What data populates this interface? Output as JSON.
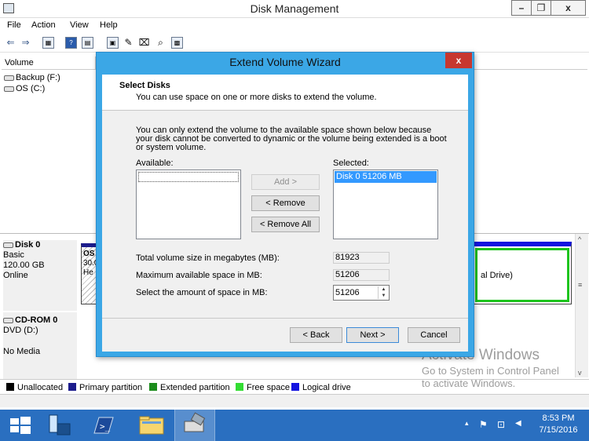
{
  "window": {
    "title": "Disk Management",
    "min": "–",
    "max": "❐",
    "close": "x"
  },
  "menu": [
    "File",
    "Action",
    "View",
    "Help"
  ],
  "toolbar": {
    "back": "⇐",
    "forward": "⇒",
    "btn3": "▦",
    "btn4": "?",
    "btn5": "▤",
    "btn6": "▣",
    "btn7": "✎",
    "btn8": "⌧",
    "btn9": "⌕",
    "btn10": "▩"
  },
  "volume_list": {
    "column": "Volume",
    "rows": [
      "Backup (F:)",
      "OS (C:)"
    ]
  },
  "disks": {
    "disk0": {
      "name": "Disk 0",
      "type": "Basic",
      "size": "120.00 GB",
      "status": "Online",
      "part1_lines": [
        "OS",
        "30.0",
        "He"
      ],
      "part2_text": "al Drive)"
    },
    "cdrom": {
      "name": "CD-ROM 0",
      "type": "DVD (D:)",
      "status": "No Media"
    }
  },
  "legend": [
    {
      "label": "Unallocated",
      "color": "#000000"
    },
    {
      "label": "Primary partition",
      "color": "#1c1c8c"
    },
    {
      "label": "Extended partition",
      "color": "#1c8c1c"
    },
    {
      "label": "Free space",
      "color": "#33dd33"
    },
    {
      "label": "Logical drive",
      "color": "#1313e0"
    }
  ],
  "activate": {
    "line1": "Activate Windows",
    "line2": "Go to System in Control Panel",
    "line3": "to activate Windows."
  },
  "dialog": {
    "title": "Extend Volume Wizard",
    "close": "x",
    "heading": "Select Disks",
    "subheading": "You can use space on one or more disks to extend the volume.",
    "description": "You can only extend the volume to the available space shown below because your disk cannot be converted to dynamic or the volume being extended is a boot or system volume.",
    "available_label": "Available:",
    "selected_label": "Selected:",
    "selected_item": "Disk 0     51206 MB",
    "add": "Add >",
    "remove": "< Remove",
    "remove_all": "< Remove All",
    "total_label": "Total volume size in megabytes (MB):",
    "total_value": "81923",
    "max_label": "Maximum available space in MB:",
    "max_value": "51206",
    "amount_label": "Select the amount of space in MB:",
    "amount_value": "51206",
    "back": "< Back",
    "next": "Next >",
    "cancel": "Cancel"
  },
  "tray": {
    "arrow": "▴",
    "flag": "⚑",
    "network": "⊡",
    "volume": "◀",
    "time": "8:53 PM",
    "date": "7/15/2016"
  },
  "scroll": {
    "up": "^",
    "down": "v",
    "mid": "≡"
  }
}
